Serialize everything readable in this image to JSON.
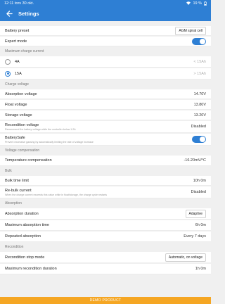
{
  "status": {
    "time": "12:11",
    "date": "tors 30 okt.",
    "battery": "19 %"
  },
  "header": {
    "title": "Settings"
  },
  "rows": {
    "battery_preset": {
      "label": "Battery preset",
      "value": "AGM spiral cell"
    },
    "expert_mode": {
      "label": "Expert mode"
    },
    "max_current_section": "Maximum charge current",
    "opt_4a": {
      "label": "4A",
      "note": "< 15Ah"
    },
    "opt_15a": {
      "label": "15A",
      "note": "> 15Ah"
    },
    "charge_voltage_section": "Charge voltage",
    "absorption_voltage": {
      "label": "Absorption voltage",
      "value": "14.70V"
    },
    "float_voltage": {
      "label": "Float voltage",
      "value": "13.80V"
    },
    "storage_voltage": {
      "label": "Storage voltage",
      "value": "13.20V"
    },
    "recondition_voltage": {
      "label": "Recondition voltage",
      "sub": "Recommend the battery voltage while the controller below 1.2A",
      "value": "Disabled"
    },
    "batterysafe": {
      "label": "BatterySafe",
      "sub": "Prevent excessive gassing by automatically limiting the rate of voltage increase"
    },
    "voltage_comp_section": "Voltage compensation",
    "temp_comp": {
      "label": "Temperature compensation",
      "value": "-16.20mV/°C"
    },
    "bulk_section": "Bulk",
    "bulk_time_limit": {
      "label": "Bulk time limit",
      "value": "10h 0m"
    },
    "rebulk_current": {
      "label": "Re-bulk current",
      "sub": "When the charge current exceeds this value while in float/storage, the charge cycle restarts",
      "value": "Disabled"
    },
    "absorption_section": "Absorption",
    "absorption_duration": {
      "label": "Absorption duration",
      "value": "Adaptive"
    },
    "max_absorption_time": {
      "label": "Maximum absorption time",
      "value": "6h 0m"
    },
    "repeated_absorption": {
      "label": "Repeated absorption",
      "value": "Every 7 days"
    },
    "recondition_section": "Recondition",
    "recondition_stop_mode": {
      "label": "Recondition stop mode",
      "value": "Automatic, on voltage"
    },
    "max_recondition_duration": {
      "label": "Maximum recondition duration",
      "value": "1h 0m"
    }
  },
  "footer": {
    "label": "DEMO PRODUCT"
  },
  "colors": {
    "accent": "#2e7fd4",
    "footer": "#f5a623"
  }
}
